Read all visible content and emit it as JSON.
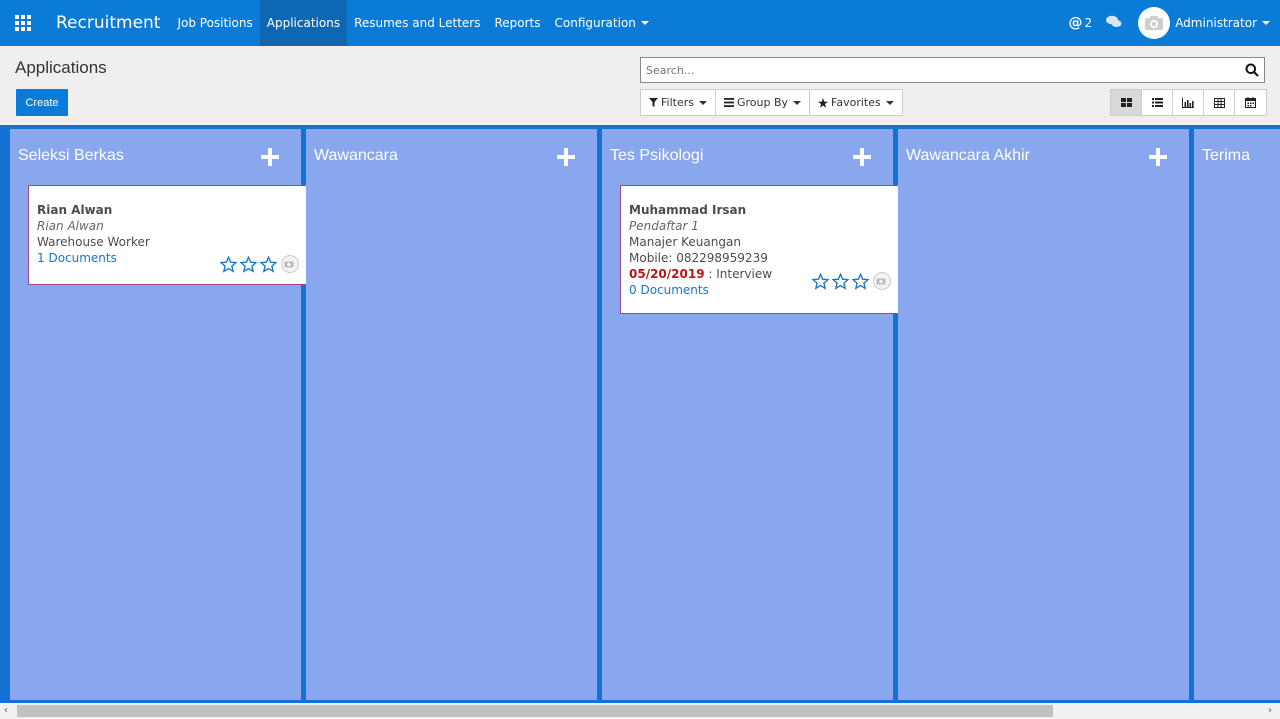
{
  "navbar": {
    "apps_icon": "apps-grid-icon",
    "brand": "Recruitment",
    "menu": [
      {
        "label": "Job Positions",
        "active": false
      },
      {
        "label": "Applications",
        "active": true
      },
      {
        "label": "Resumes and Letters",
        "active": false
      },
      {
        "label": "Reports",
        "active": false
      },
      {
        "label": "Configuration",
        "active": false
      }
    ],
    "mention_count": "2",
    "user": "Administrator"
  },
  "control": {
    "breadcrumb": "Applications",
    "create_label": "Create",
    "search_placeholder": "Search...",
    "filters_label": "Filters",
    "groupby_label": "Group By",
    "favorites_label": "Favorites"
  },
  "columns": [
    {
      "title": "Seleksi Berkas"
    },
    {
      "title": "Wawancara"
    },
    {
      "title": "Tes Psikologi"
    },
    {
      "title": "Wawancara Akhir"
    },
    {
      "title": "Terima"
    }
  ],
  "cards": {
    "rian": {
      "name": "Rian Alwan",
      "subtitle": "Rian Alwan",
      "job": "Warehouse Worker",
      "documents": "1 Documents"
    },
    "irsan": {
      "name": "Muhammad Irsan",
      "subtitle": "Pendaftar 1",
      "job": "Manajer Keuangan",
      "mobile": "Mobile: 082298959239",
      "date": "05/20/2019",
      "activity": " : Interview",
      "documents": "0 Documents"
    }
  },
  "colors": {
    "navbar": "#0a7bd6",
    "kanban_bg": "#1272d6",
    "column_bg": "#89a7ef",
    "card_border": "#a24689",
    "link": "#1a76c5",
    "date_overdue": "#b41717"
  }
}
